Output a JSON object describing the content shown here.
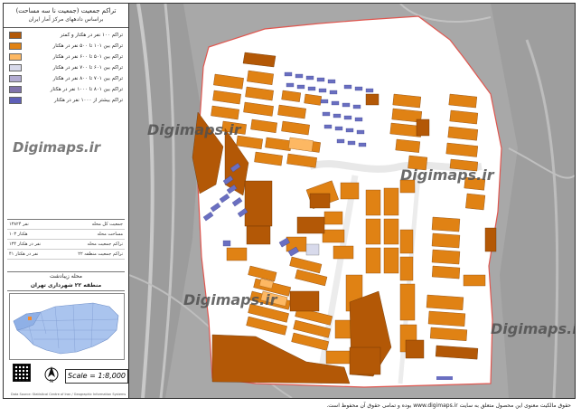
{
  "header": {
    "title": "تراکم جمعیت (جمعیت نا سه مساحت)",
    "subtitle": "براساس دادههای مرکز آمار ایران"
  },
  "legend": [
    {
      "label": "تراکم ۱۰۰ نفر در هکتار و کمتر",
      "color": "#b35806"
    },
    {
      "label": "تراکم بین ۱۰۱ تا ۵۰۰ نفر در هکتار",
      "color": "#e08214"
    },
    {
      "label": "تراکم بین ۵۰۱ تا ۶۰۰ نفر در هکتار",
      "color": "#fdb863"
    },
    {
      "label": "تراکم بین ۶۰۱ تا ۷۰۰ نفر در هکتار",
      "color": "#d8daeb"
    },
    {
      "label": "تراکم بین ۷۰۱ تا ۸۰۰ نفر در هکتار",
      "color": "#b2abd2"
    },
    {
      "label": "تراکم بین ۸۰۱ تا ۱۰۰۰ نفر در هکتار",
      "color": "#8073ac"
    },
    {
      "label": "تراکم بیشتر از ۱۰۰۰ نفر در هکتار",
      "color": "#5e5fb8"
    }
  ],
  "stats": [
    {
      "label": "جمعیت کل محله",
      "value": "۱۳۸۲۴ نفر"
    },
    {
      "label": "مساحت محله",
      "value": "۱۰۳ هکتار"
    },
    {
      "label": "تراکم جمعیت محله",
      "value": "۱۳۴ نفر در هکتار"
    },
    {
      "label": "تراکم جمعیت منطقه ۲۲",
      "value": "۴۱ نفر در هکتار"
    }
  ],
  "location": {
    "name": "محله زیبادشت",
    "district": "منطقه ۲۲ شهرداری تهران"
  },
  "scale": "Scale = 1:8,000",
  "watermark": "Digimaps.ir",
  "credit": "Data Source: Statistical Centre of Iran / Geographic Information Systems",
  "footer": "حقوق مالکیت معنوی این محصول متعلق به سایت www.digimaps.ir بوده و تمامی حقوق آن محفوظ است.",
  "colors": {
    "low": "#b35806",
    "mid": "#e08214",
    "light": "#fdb863",
    "high": "#6a6fc1",
    "boundary": "#e0564f"
  }
}
